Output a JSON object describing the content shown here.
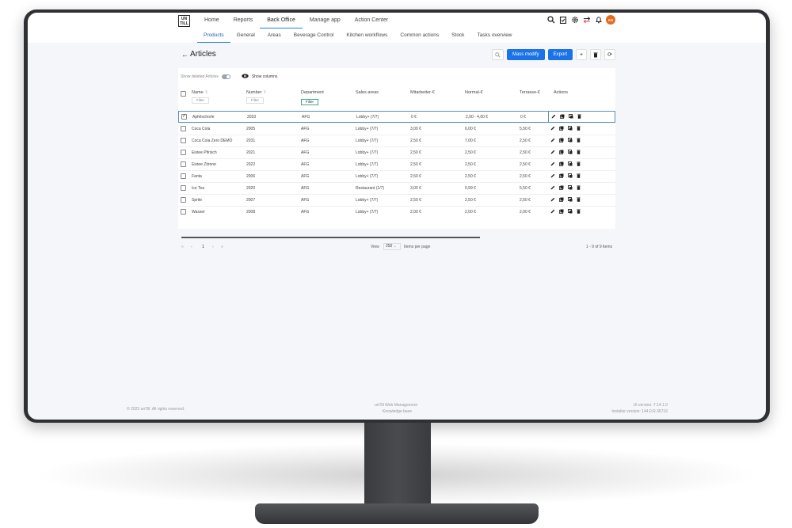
{
  "logo_text": "UN TILL",
  "main_nav": [
    "Home",
    "Reports",
    "Back Office",
    "Manage app",
    "Action Center"
  ],
  "main_nav_active": "Back Office",
  "sub_nav": [
    "Products",
    "General",
    "Areas",
    "Beverage Control",
    "Kitchen workflows",
    "Common actions",
    "Stock",
    "Tasks overview"
  ],
  "sub_nav_active": "Products",
  "header_icons": [
    "search-icon",
    "clipboard-icon",
    "gear-icon",
    "transfer-icon",
    "bell-icon"
  ],
  "avatar": "AG",
  "page": {
    "back_arrow": "←",
    "title": "Articles",
    "mass_modify": "Mass modify",
    "export": "Export",
    "add": "+",
    "delete": "🗑",
    "refresh": "⟳"
  },
  "toolbar": {
    "show_deleted": "Show deleted Articles",
    "show_columns": "Show columns"
  },
  "columns": [
    "Name",
    "Number",
    "Department",
    "Sales areas",
    "Mitarbeiter-€",
    "Normal-€",
    "Terrasse-€",
    "Actions"
  ],
  "filter_label": "Filter",
  "rows": [
    {
      "name": "Apfelschorle",
      "number": "2033",
      "dept": "AFG",
      "sales": "Lobby+ (7/7)",
      "mitarbeiter": "0 €",
      "normal": "2,00 - 4,00 €",
      "terrasse": "0 €",
      "checked": true
    },
    {
      "name": "Coca Cola",
      "number": "2005",
      "dept": "AFG",
      "sales": "Lobby+ (7/7)",
      "mitarbeiter": "3,00 €",
      "normal": "6,00 €",
      "terrasse": "5,50 €",
      "checked": false
    },
    {
      "name": "Coca Cola Zero DEMO",
      "number": "2031",
      "dept": "AFG",
      "sales": "Lobby+ (7/7)",
      "mitarbeiter": "2,50 €",
      "normal": "7,00 €",
      "terrasse": "2,50 €",
      "checked": false
    },
    {
      "name": "Eistee Pfirsich",
      "number": "2021",
      "dept": "AFG",
      "sales": "Lobby+ (7/7)",
      "mitarbeiter": "2,50 €",
      "normal": "2,50 €",
      "terrasse": "2,50 €",
      "checked": false
    },
    {
      "name": "Eistee Zitrone",
      "number": "2022",
      "dept": "AFG",
      "sales": "Lobby+ (7/7)",
      "mitarbeiter": "2,50 €",
      "normal": "2,50 €",
      "terrasse": "2,50 €",
      "checked": false
    },
    {
      "name": "Fanta",
      "number": "2006",
      "dept": "AFG",
      "sales": "Lobby+ (7/7)",
      "mitarbeiter": "2,50 €",
      "normal": "2,50 €",
      "terrasse": "2,50 €",
      "checked": false
    },
    {
      "name": "Ice Tea",
      "number": "2020",
      "dept": "AFG",
      "sales": "Restaurant (1/7)",
      "mitarbeiter": "3,00 €",
      "normal": "0,99 €",
      "terrasse": "5,50 €",
      "checked": false
    },
    {
      "name": "Sprite",
      "number": "2007",
      "dept": "AFG",
      "sales": "Lobby+ (7/7)",
      "mitarbeiter": "2,50 €",
      "normal": "2,50 €",
      "terrasse": "2,50 €",
      "checked": false
    },
    {
      "name": "Wasser",
      "number": "2008",
      "dept": "AFG",
      "sales": "Lobby+ (7/7)",
      "mitarbeiter": "2,00 €",
      "normal": "2,00 €",
      "terrasse": "2,00 €",
      "checked": false
    }
  ],
  "row_action_icons": [
    "edit-icon",
    "copy-icon",
    "duplicate-icon",
    "delete-icon"
  ],
  "pagination": {
    "first": "«",
    "prev": "‹",
    "page": "1",
    "next": "›",
    "last": "»",
    "view_label": "View",
    "page_size": "250",
    "items_per_page": "Items per page",
    "summary": "1 - 9 of 9 items"
  },
  "footer": {
    "copyright": "© 2023 unTill. All rights reserved.",
    "app_name": "unTill Web Management",
    "knowledge_base": "Knowledge base",
    "ui_version": "UI version: 7.14.1.0",
    "installer_version": "Installer version: 144.0.R.36716"
  },
  "colors": {
    "accent": "#1a73e8",
    "avatar": "#e46a1f",
    "bezel": "#2f3033"
  }
}
